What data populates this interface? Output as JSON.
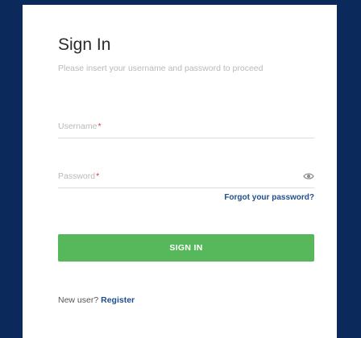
{
  "form": {
    "title": "Sign In",
    "subtitle": "Please insert your username and password to proceed",
    "username": {
      "label": "Username",
      "required_mark": "*",
      "value": ""
    },
    "password": {
      "label": "Password",
      "required_mark": "*",
      "value": "",
      "toggle_icon": "eye-icon"
    },
    "forgot_link": "Forgot your password?",
    "submit_label": "SIGN IN",
    "new_user_text": "New user?",
    "register_link": "Register"
  },
  "colors": {
    "background": "#0b2a5b",
    "card": "#ffffff",
    "primary_button": "#57b75b",
    "link": "#1d4f8a",
    "required": "#d43a3a"
  }
}
